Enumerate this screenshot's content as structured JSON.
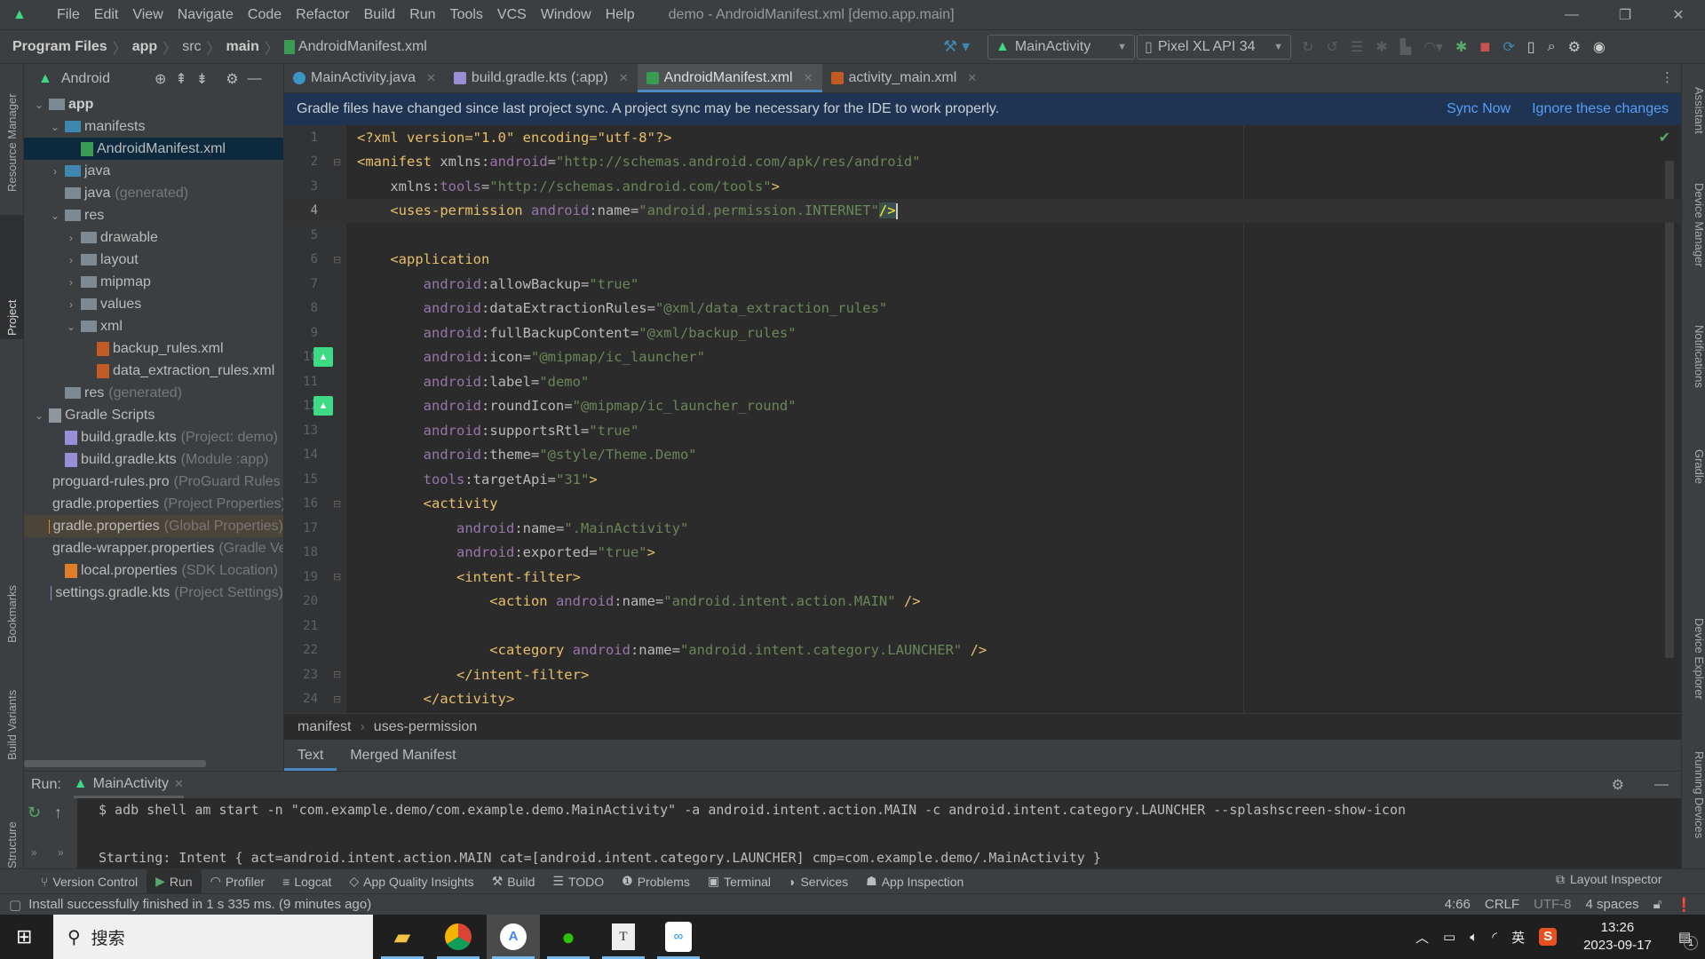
{
  "window": {
    "title": "demo - AndroidManifest.xml [demo.app.main]",
    "menu": [
      "File",
      "Edit",
      "View",
      "Navigate",
      "Code",
      "Refactor",
      "Build",
      "Run",
      "Tools",
      "VCS",
      "Window",
      "Help"
    ],
    "controls": {
      "minimize": "—",
      "restore": "❐",
      "close": "✕"
    }
  },
  "navbar": {
    "breadcrumb": [
      "Program Files",
      "app",
      "src",
      "main",
      "AndroidManifest.xml"
    ],
    "run_config": "MainActivity",
    "device": "Pixel XL API 34"
  },
  "left_stripe": [
    "Resource Manager",
    "Project",
    "Bookmarks",
    "Build Variants",
    "Structure"
  ],
  "right_stripe": [
    "Assistant",
    "Device Manager",
    "Notifications",
    "Gradle",
    "Device Explorer",
    "Running Devices"
  ],
  "project": {
    "view": "Android",
    "tree": [
      {
        "label": "app",
        "level": 0,
        "chev": "v",
        "icon": "module",
        "bold": true
      },
      {
        "label": "manifests",
        "level": 1,
        "chev": "v",
        "icon": "folder-blue"
      },
      {
        "label": "AndroidManifest.xml",
        "level": 2,
        "chev": "",
        "icon": "manifest",
        "selected": true
      },
      {
        "label": "java",
        "level": 1,
        "chev": ">",
        "icon": "folder-blue"
      },
      {
        "label": "java",
        "dim": "(generated)",
        "level": 1,
        "chev": "",
        "icon": "folder-gen"
      },
      {
        "label": "res",
        "level": 1,
        "chev": "v",
        "icon": "folder-res"
      },
      {
        "label": "drawable",
        "level": 2,
        "chev": ">",
        "icon": "folder"
      },
      {
        "label": "layout",
        "level": 2,
        "chev": ">",
        "icon": "folder"
      },
      {
        "label": "mipmap",
        "level": 2,
        "chev": ">",
        "icon": "folder"
      },
      {
        "label": "values",
        "level": 2,
        "chev": ">",
        "icon": "folder"
      },
      {
        "label": "xml",
        "level": 2,
        "chev": "v",
        "icon": "folder"
      },
      {
        "label": "backup_rules.xml",
        "level": 3,
        "chev": "",
        "icon": "xml"
      },
      {
        "label": "data_extraction_rules.xml",
        "level": 3,
        "chev": "",
        "icon": "xml"
      },
      {
        "label": "res",
        "dim": "(generated)",
        "level": 1,
        "chev": "",
        "icon": "folder-res"
      },
      {
        "label": "Gradle Scripts",
        "level": 0,
        "chev": "v",
        "icon": "gradle"
      },
      {
        "label": "build.gradle.kts",
        "dim": "(Project: demo)",
        "level": 1,
        "chev": "",
        "icon": "gradle-kts"
      },
      {
        "label": "build.gradle.kts",
        "dim": "(Module :app)",
        "level": 1,
        "chev": "",
        "icon": "gradle-kts"
      },
      {
        "label": "proguard-rules.pro",
        "dim": "(ProGuard Rules for \":app\")",
        "level": 1,
        "chev": "",
        "icon": "text"
      },
      {
        "label": "gradle.properties",
        "dim": "(Project Properties)",
        "level": 1,
        "chev": "",
        "icon": "props"
      },
      {
        "label": "gradle.properties",
        "dim": "(Global Properties)",
        "level": 1,
        "chev": "",
        "icon": "props",
        "highlight": true
      },
      {
        "label": "gradle-wrapper.properties",
        "dim": "(Gradle Version)",
        "level": 1,
        "chev": "",
        "icon": "props"
      },
      {
        "label": "local.properties",
        "dim": "(SDK Location)",
        "level": 1,
        "chev": "",
        "icon": "props"
      },
      {
        "label": "settings.gradle.kts",
        "dim": "(Project Settings)",
        "level": 1,
        "chev": "",
        "icon": "gradle-kts"
      }
    ]
  },
  "editor": {
    "tabs": [
      {
        "label": "MainActivity.java",
        "icon": "java-class-icon",
        "active": false
      },
      {
        "label": "build.gradle.kts (:app)",
        "icon": "gradle-kts-icon",
        "active": false
      },
      {
        "label": "AndroidManifest.xml",
        "icon": "manifest-icon",
        "active": true
      },
      {
        "label": "activity_main.xml",
        "icon": "xml-layout-icon",
        "active": false
      }
    ],
    "banner": {
      "message": "Gradle files have changed since last project sync. A project sync may be necessary for the IDE to work properly.",
      "sync_now": "Sync Now",
      "ignore": "Ignore these changes"
    },
    "current_line": 4,
    "lines": [
      [
        [
          "t",
          "<?xml version=\"1.0\" encoding=\"utf-8\"?>"
        ]
      ],
      [
        [
          "t",
          "<manifest "
        ],
        [
          "n",
          "xmlns:"
        ],
        [
          "a",
          "android"
        ],
        [
          "n",
          "="
        ],
        [
          "v",
          "\"http://schemas.android.com/apk/res/android\""
        ]
      ],
      [
        [
          "n",
          "    xmlns:"
        ],
        [
          "a",
          "tools"
        ],
        [
          "n",
          "="
        ],
        [
          "v",
          "\"http://schemas.android.com/tools\""
        ],
        [
          "t",
          ">"
        ]
      ],
      [
        [
          "t",
          "    <uses-permission "
        ],
        [
          "a",
          "android"
        ],
        [
          "n",
          ":name="
        ],
        [
          "v",
          "\"android.permission.INTERNET\""
        ],
        [
          "t",
          "/>"
        ]
      ],
      [],
      [
        [
          "t",
          "    <application"
        ]
      ],
      [
        [
          "a",
          "        android"
        ],
        [
          "n",
          ":allowBackup="
        ],
        [
          "v",
          "\"true\""
        ]
      ],
      [
        [
          "a",
          "        android"
        ],
        [
          "n",
          ":dataExtractionRules="
        ],
        [
          "v",
          "\"@xml/data_extraction_rules\""
        ]
      ],
      [
        [
          "a",
          "        android"
        ],
        [
          "n",
          ":fullBackupContent="
        ],
        [
          "v",
          "\"@xml/backup_rules\""
        ]
      ],
      [
        [
          "a",
          "        android"
        ],
        [
          "n",
          ":icon="
        ],
        [
          "v",
          "\"@mipmap/ic_launcher\""
        ]
      ],
      [
        [
          "a",
          "        android"
        ],
        [
          "n",
          ":label="
        ],
        [
          "v",
          "\"demo\""
        ]
      ],
      [
        [
          "a",
          "        android"
        ],
        [
          "n",
          ":roundIcon="
        ],
        [
          "v",
          "\"@mipmap/ic_launcher_round\""
        ]
      ],
      [
        [
          "a",
          "        android"
        ],
        [
          "n",
          ":supportsRtl="
        ],
        [
          "v",
          "\"true\""
        ]
      ],
      [
        [
          "a",
          "        android"
        ],
        [
          "n",
          ":theme="
        ],
        [
          "v",
          "\"@style/Theme.Demo\""
        ]
      ],
      [
        [
          "a",
          "        tools"
        ],
        [
          "n",
          ":targetApi="
        ],
        [
          "v",
          "\"31\""
        ],
        [
          "t",
          ">"
        ]
      ],
      [
        [
          "t",
          "        <activity"
        ]
      ],
      [
        [
          "a",
          "            android"
        ],
        [
          "n",
          ":name="
        ],
        [
          "v",
          "\".MainActivity\""
        ]
      ],
      [
        [
          "a",
          "            android"
        ],
        [
          "n",
          ":exported="
        ],
        [
          "v",
          "\"true\""
        ],
        [
          "t",
          ">"
        ]
      ],
      [
        [
          "t",
          "            <intent-filter>"
        ]
      ],
      [
        [
          "t",
          "                <action "
        ],
        [
          "a",
          "android"
        ],
        [
          "n",
          ":name="
        ],
        [
          "v",
          "\"android.intent.action.MAIN\""
        ],
        [
          "t",
          " />"
        ]
      ],
      [],
      [
        [
          "t",
          "                <category "
        ],
        [
          "a",
          "android"
        ],
        [
          "n",
          ":name="
        ],
        [
          "v",
          "\"android.intent.category.LAUNCHER\""
        ],
        [
          "t",
          " />"
        ]
      ],
      [
        [
          "t",
          "            </intent-filter>"
        ]
      ],
      [
        [
          "t",
          "        </activity>"
        ]
      ]
    ],
    "gutter_icons": [
      10,
      12
    ],
    "folds": [
      2,
      6,
      16,
      19,
      23,
      24
    ],
    "breadcrumb": [
      "manifest",
      "uses-permission"
    ],
    "bottom_tabs": [
      {
        "label": "Text",
        "active": true
      },
      {
        "label": "Merged Manifest",
        "active": false
      }
    ]
  },
  "run": {
    "label": "Run:",
    "tab": "MainActivity",
    "lines": [
      "$ adb shell am start -n \"com.example.demo/com.example.demo.MainActivity\" -a android.intent.action.MAIN -c android.intent.category.LAUNCHER --splashscreen-show-icon",
      "",
      "Starting: Intent { act=android.intent.action.MAIN cat=[android.intent.category.LAUNCHER] cmp=com.example.demo/.MainActivity }"
    ]
  },
  "toolwindows": [
    {
      "label": "Version Control",
      "icon": "⑂"
    },
    {
      "label": "Run",
      "icon": "▶",
      "active": true
    },
    {
      "label": "Profiler",
      "icon": "◠"
    },
    {
      "label": "Logcat",
      "icon": "≡"
    },
    {
      "label": "App Quality Insights",
      "icon": "◇"
    },
    {
      "label": "Build",
      "icon": "⚒"
    },
    {
      "label": "TODO",
      "icon": "☰"
    },
    {
      "label": "Problems",
      "icon": "❶"
    },
    {
      "label": "Terminal",
      "icon": "▣"
    },
    {
      "label": "Services",
      "icon": "◗"
    },
    {
      "label": "App Inspection",
      "icon": "☗"
    }
  ],
  "layout_inspector": "Layout Inspector",
  "status": {
    "message": "Install successfully finished in 1 s 335 ms. (9 minutes ago)",
    "position": "4:66",
    "line_sep": "CRLF",
    "encoding": "UTF-8",
    "indent": "4 spaces"
  },
  "taskbar": {
    "search": "搜索",
    "apps": [
      "File Explorer",
      "Chrome",
      "Android Studio",
      "WeChat",
      "Typora",
      "Baidu Netdisk"
    ],
    "ime": "英",
    "time": "13:26",
    "date": "2023-09-17",
    "notifications": "1"
  }
}
